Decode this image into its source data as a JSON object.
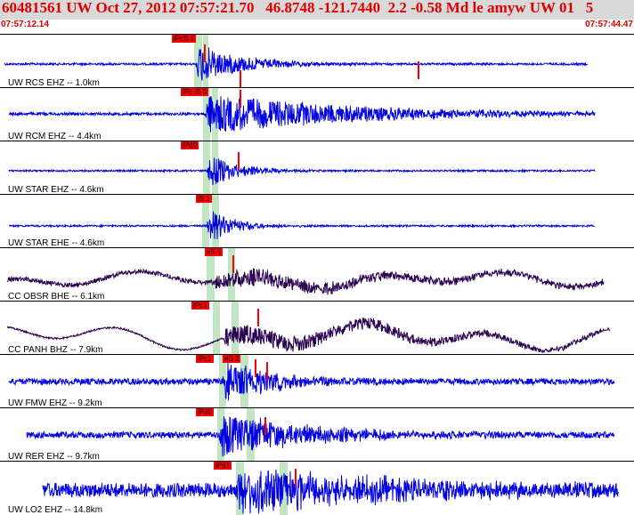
{
  "header": {
    "title": "60481561 UW Oct 27, 2012 07:57:21.70   46.8748 -121.7440  2.2 -0.58 Md le amyw UW 01   5",
    "time_start": "07:57:12.14",
    "time_end": "07:57:44.47"
  },
  "colors": {
    "trace_blue": "#0000e0",
    "trace_dark": "#2a0050",
    "pick_red": "#ff0000",
    "window_green": "#7cc87c",
    "title_red": "#e00000"
  },
  "stations": [
    {
      "label": "UW RCS EHZ -- 1.0km",
      "picks": [
        "iPcS 1"
      ],
      "color": "blue"
    },
    {
      "label": "UW RCM EHZ -- 4.4km",
      "picks": [
        "iPc iS 0"
      ],
      "color": "blue"
    },
    {
      "label": "UW STAR EHZ -- 4.6km",
      "picks": [
        "iPd0"
      ],
      "color": "blue"
    },
    {
      "label": "UW STAR EHE -- 4.6km",
      "picks": [
        "iS 1"
      ],
      "color": "blue"
    },
    {
      "label": "CC OBSR BHE -- 6.1km",
      "picks": [
        "eS 1"
      ],
      "color": "dark"
    },
    {
      "label": "CC PANH BHZ -- 7.9km",
      "picks": [
        "iPc1"
      ],
      "color": "dark"
    },
    {
      "label": "UW FMW EHZ -- 9.2km",
      "picks": [
        "iPc1",
        "eS 2"
      ],
      "color": "blue"
    },
    {
      "label": "UW RER EHZ -- 9.7km",
      "picks": [
        "iPd0"
      ],
      "color": "blue"
    },
    {
      "label": "UW LO2 EHZ -- 14.8km",
      "picks": [
        "iPd1"
      ],
      "color": "blue"
    }
  ]
}
